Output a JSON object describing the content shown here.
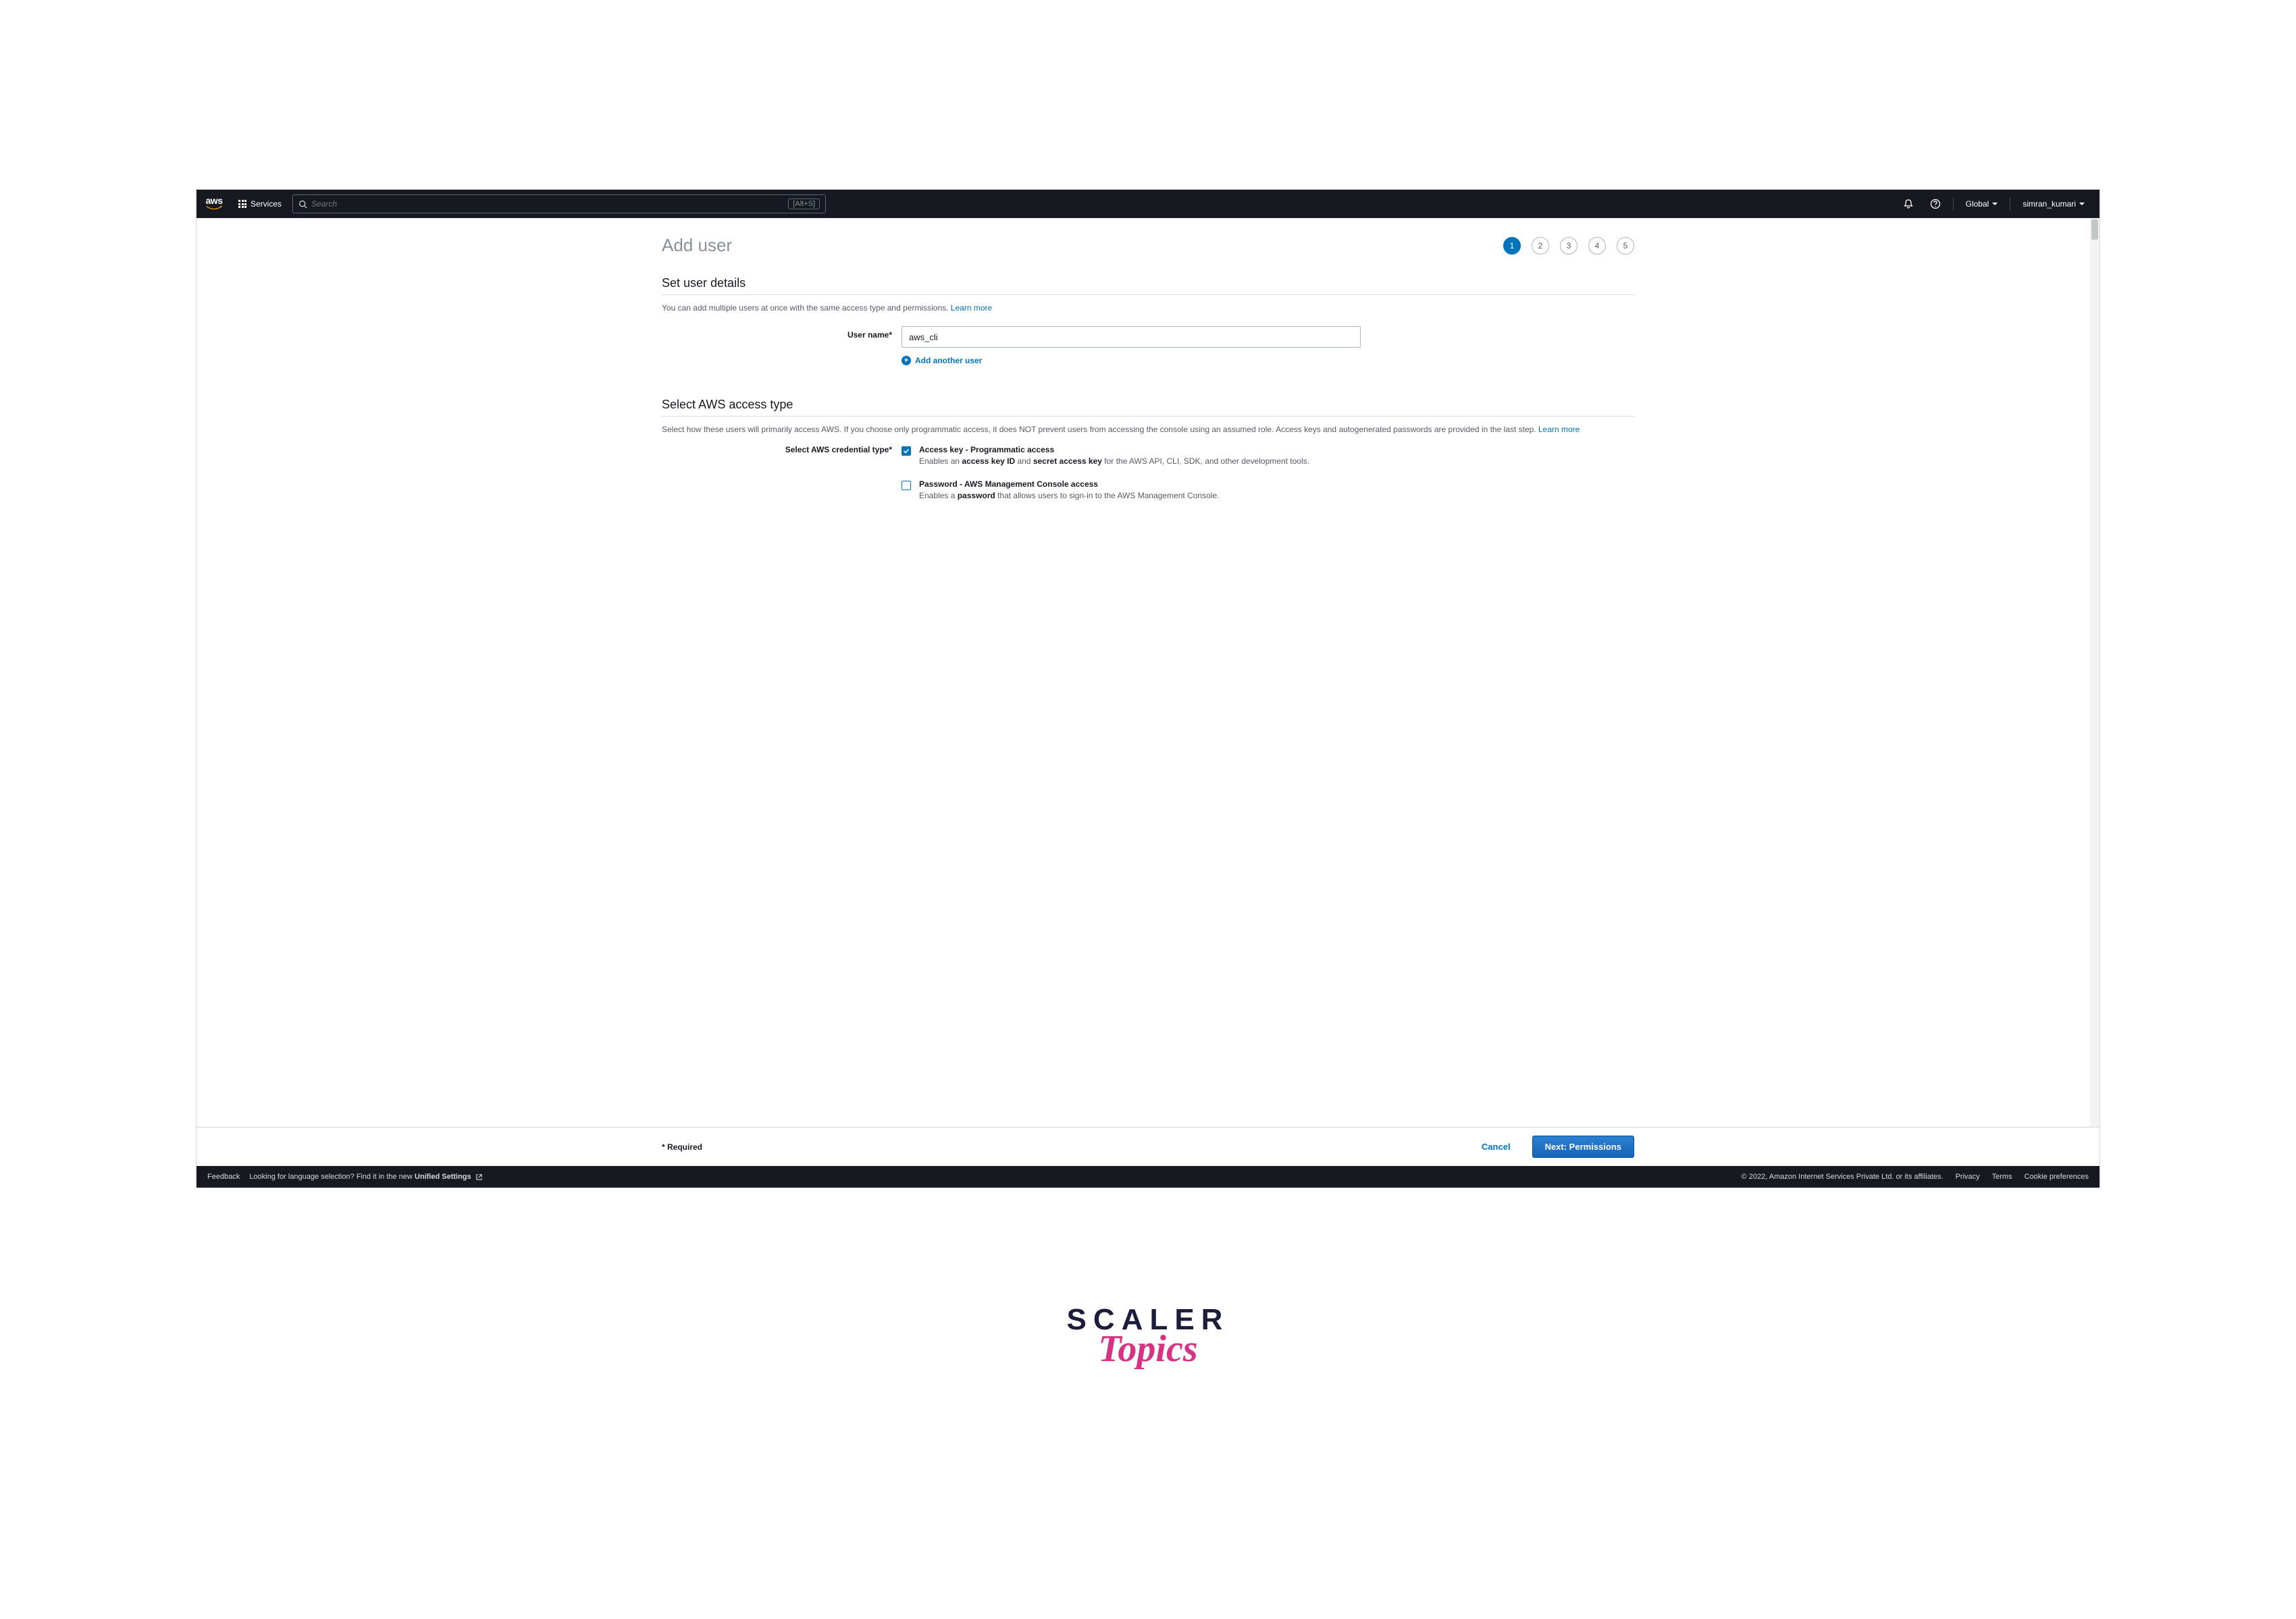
{
  "topnav": {
    "services_label": "Services",
    "search_placeholder": "Search",
    "search_shortcut": "[Alt+S]",
    "region": "Global",
    "account": "simran_kumari"
  },
  "page": {
    "title": "Add user",
    "steps": [
      "1",
      "2",
      "3",
      "4",
      "5"
    ],
    "active_step": 1
  },
  "section_user_details": {
    "title": "Set user details",
    "helper": "You can add multiple users at once with the same access type and permissions.",
    "helper_link": "Learn more",
    "username_label": "User name*",
    "username_value": "aws_cli",
    "add_another": "Add another user"
  },
  "section_access": {
    "title": "Select AWS access type",
    "helper": "Select how these users will primarily access AWS. If you choose only programmatic access, it does NOT prevent users from accessing the console using an assumed role. Access keys and autogenerated passwords are provided in the last step.",
    "helper_link": "Learn more",
    "cred_label": "Select AWS credential type*",
    "options": [
      {
        "checked": true,
        "title": "Access key - Programmatic access",
        "desc_pre": "Enables an ",
        "desc_b1": "access key ID",
        "desc_mid": " and ",
        "desc_b2": "secret access key",
        "desc_post": " for the AWS API, CLI, SDK, and other development tools."
      },
      {
        "checked": false,
        "title": "Password - AWS Management Console access",
        "desc_pre": "Enables a ",
        "desc_b1": "password",
        "desc_mid": "",
        "desc_b2": "",
        "desc_post": " that allows users to sign-in to the AWS Management Console."
      }
    ]
  },
  "bottom": {
    "required": "* Required",
    "cancel": "Cancel",
    "next": "Next: Permissions"
  },
  "footer": {
    "feedback": "Feedback",
    "lang_pre": "Looking for language selection? Find it in the new ",
    "lang_link": "Unified Settings",
    "copyright": "© 2022, Amazon Internet Services Private Ltd. or its affiliates.",
    "privacy": "Privacy",
    "terms": "Terms",
    "cookies": "Cookie preferences"
  },
  "watermark": {
    "line1": "SCALER",
    "line2": "Topics"
  }
}
